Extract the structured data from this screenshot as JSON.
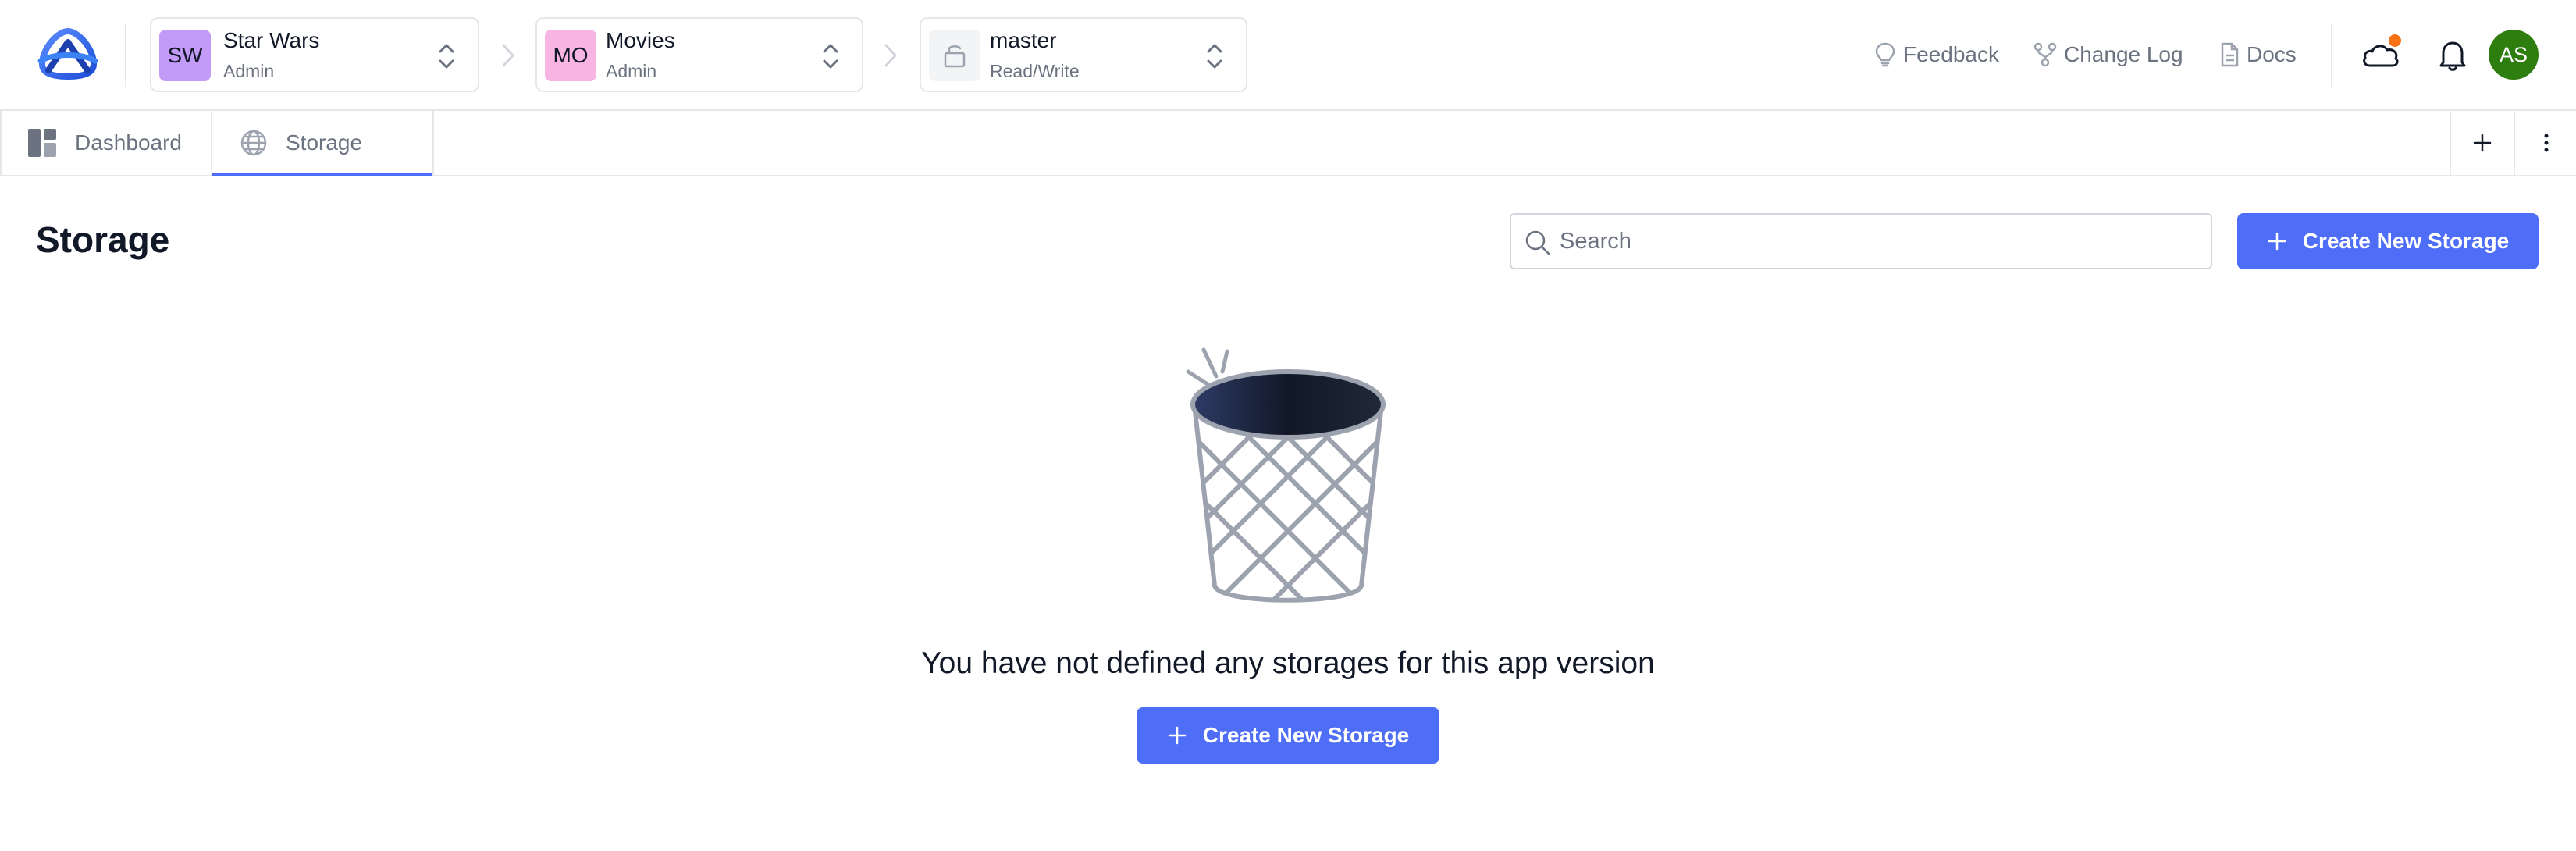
{
  "header": {
    "workspace": {
      "initials": "SW",
      "name": "Star Wars",
      "role": "Admin",
      "badge_color": "#c39af7"
    },
    "app": {
      "initials": "MO",
      "name": "Movies",
      "role": "Admin",
      "badge_color": "#f8b4e3"
    },
    "branch": {
      "icon": "lock-icon",
      "name": "master",
      "access": "Read/Write"
    },
    "links": [
      {
        "label": "Feedback",
        "icon": "lightbulb-icon"
      },
      {
        "label": "Change Log",
        "icon": "git-fork-icon"
      },
      {
        "label": "Docs",
        "icon": "document-icon"
      }
    ],
    "user_initials": "AS",
    "avatar_color": "#2e7d0f",
    "notification_dot_color": "#f97316"
  },
  "tabs": [
    {
      "label": "Dashboard",
      "icon": "dashboard-icon",
      "active": false
    },
    {
      "label": "Storage",
      "icon": "globe-icon",
      "active": true
    }
  ],
  "main": {
    "title": "Storage",
    "search_placeholder": "Search",
    "search_value": "",
    "create_button_label": "Create New Storage",
    "empty_message": "You have not defined any storages for this app version",
    "empty_button_label": "Create New Storage"
  },
  "colors": {
    "accent": "#4f6ef7",
    "muted_text": "#6b7280",
    "border": "#e5e7eb"
  }
}
